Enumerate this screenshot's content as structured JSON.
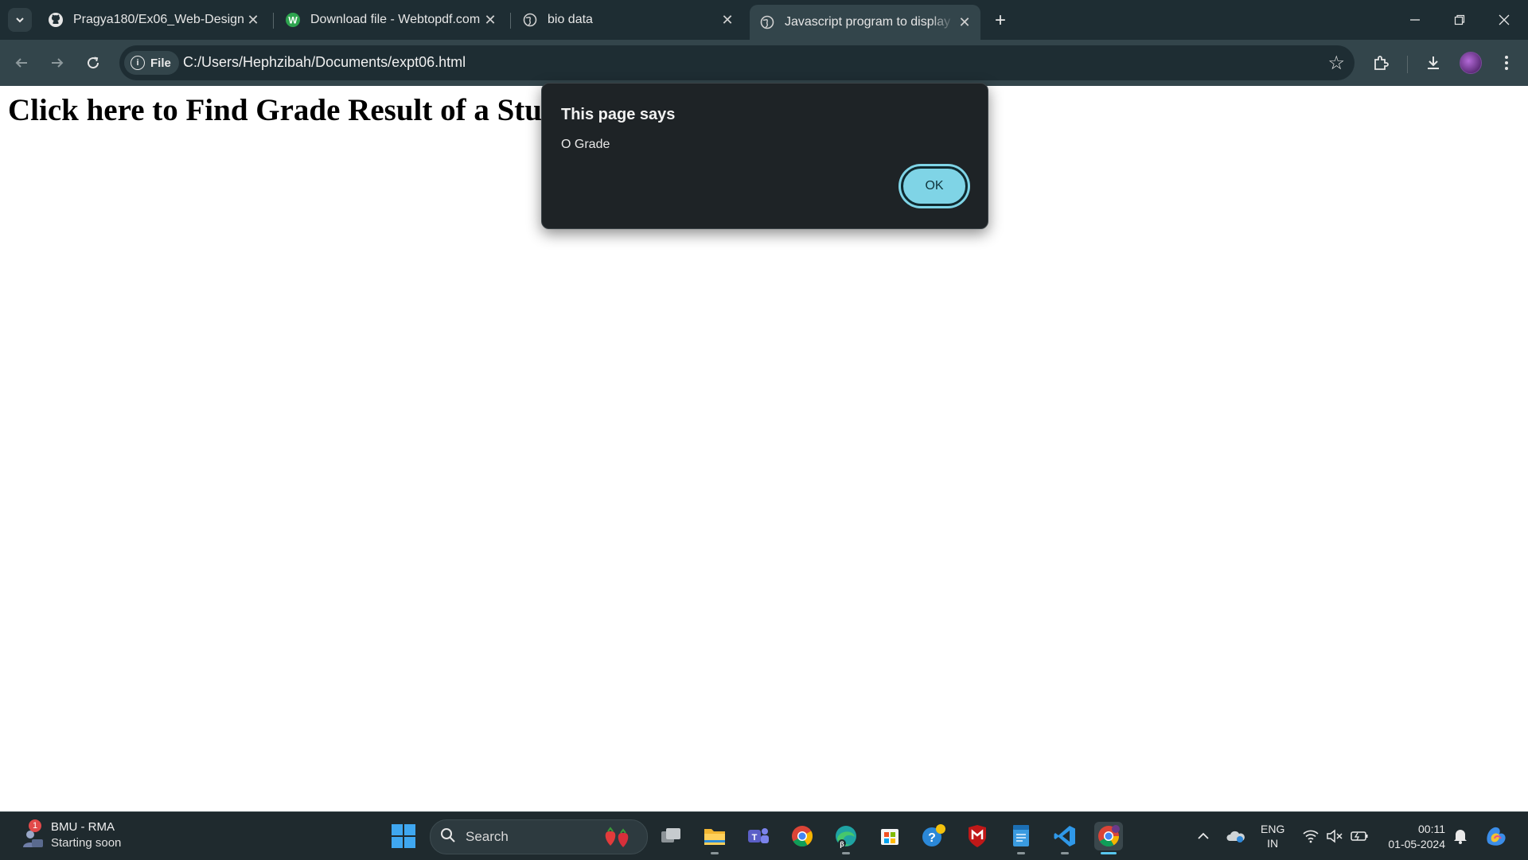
{
  "browser": {
    "tabs": [
      {
        "title": "Pragya180/Ex06_Web-Design",
        "icon": "github-icon",
        "active": false
      },
      {
        "title": "Download file - Webtopdf.com",
        "icon": "webtopdf-icon",
        "active": false
      },
      {
        "title": "bio data",
        "icon": "globe-icon",
        "active": false
      },
      {
        "title": "Javascript program to display re",
        "icon": "globe-icon",
        "active": true
      }
    ],
    "new_tab_symbol": "+",
    "address": {
      "chip_label": "File",
      "url": "C:/Users/Hephzibah/Documents/expt06.html"
    }
  },
  "page": {
    "heading": "Click here to Find Grade Result of a Student"
  },
  "dialog": {
    "title": "This page says",
    "message": "O Grade",
    "ok_label": "OK"
  },
  "taskbar": {
    "widget": {
      "badge": "1",
      "line1": "BMU - RMA",
      "line2": "Starting soon"
    },
    "search_placeholder": "Search",
    "apps": [
      "task-view",
      "file-explorer",
      "teams",
      "chrome",
      "edge-beta",
      "microsoft-store",
      "help",
      "mcafee",
      "notepad",
      "vscode",
      "chrome-active"
    ],
    "language": {
      "line1": "ENG",
      "line2": "IN"
    },
    "clock": {
      "time": "00:11",
      "date": "01-05-2024"
    }
  },
  "colors": {
    "tabbar": "#1e2d33",
    "toolbar": "#33454b",
    "dialog_bg": "#1e2326",
    "ok_button": "#7fd4e6",
    "taskbar": "#1f2a2e"
  }
}
